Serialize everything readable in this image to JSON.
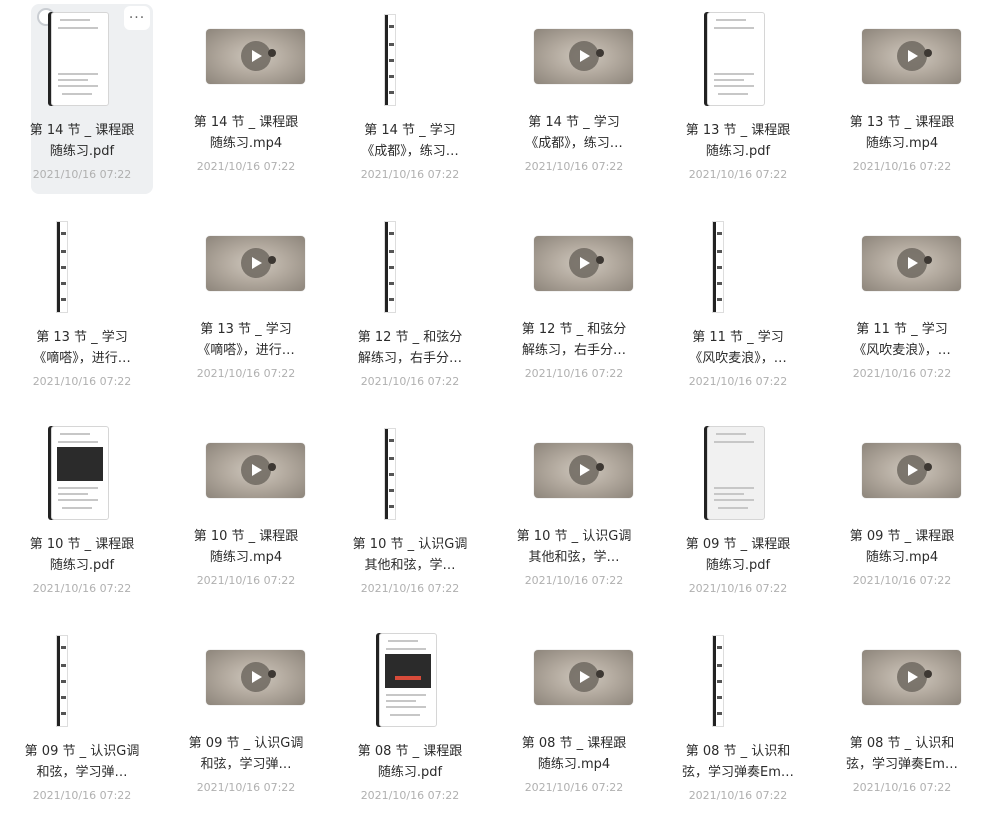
{
  "files": [
    {
      "kind": "pdf",
      "thumb": "doc-page",
      "name": "第 14 节 _ 课程跟随练习.pdf",
      "date": "2021/10/16 07:22",
      "selected": true
    },
    {
      "kind": "mp4",
      "thumb": "video",
      "name": "第 14 节 _ 课程跟随练习.mp4",
      "date": "2021/10/16 07:22"
    },
    {
      "kind": "pdf",
      "thumb": "doc-narrow",
      "name": "第 14 节 _ 学习《成都》，练习…",
      "date": "2021/10/16 07:22"
    },
    {
      "kind": "mp4",
      "thumb": "video",
      "name": "第 14 节 _ 学习《成都》，练习…",
      "date": "2021/10/16 07:22"
    },
    {
      "kind": "pdf",
      "thumb": "doc-page",
      "name": "第 13 节 _ 课程跟随练习.pdf",
      "date": "2021/10/16 07:22"
    },
    {
      "kind": "mp4",
      "thumb": "video",
      "name": "第 13 节 _ 课程跟随练习.mp4",
      "date": "2021/10/16 07:22"
    },
    {
      "kind": "pdf",
      "thumb": "doc-narrow",
      "name": "第 13 节 _ 学习《嘀嗒》，进行…",
      "date": "2021/10/16 07:22"
    },
    {
      "kind": "mp4",
      "thumb": "video",
      "name": "第 13 节 _ 学习《嘀嗒》，进行…",
      "date": "2021/10/16 07:22"
    },
    {
      "kind": "pdf",
      "thumb": "doc-narrow",
      "name": "第 12 节 _ 和弦分解练习，右手分…",
      "date": "2021/10/16 07:22"
    },
    {
      "kind": "mp4",
      "thumb": "video",
      "name": "第 12 节 _ 和弦分解练习，右手分…",
      "date": "2021/10/16 07:22"
    },
    {
      "kind": "pdf",
      "thumb": "doc-narrow",
      "name": "第 11 节 _ 学习《风吹麦浪》，…",
      "date": "2021/10/16 07:22"
    },
    {
      "kind": "mp4",
      "thumb": "video",
      "name": "第 11 节 _ 学习《风吹麦浪》，…",
      "date": "2021/10/16 07:22"
    },
    {
      "kind": "pdf",
      "thumb": "doc-page-dark",
      "name": "第 10 节 _ 课程跟随练习.pdf",
      "date": "2021/10/16 07:22"
    },
    {
      "kind": "mp4",
      "thumb": "video",
      "name": "第 10 节 _ 课程跟随练习.mp4",
      "date": "2021/10/16 07:22"
    },
    {
      "kind": "pdf",
      "thumb": "doc-narrow",
      "name": "第 10 节 _ 认识G调其他和弦，学…",
      "date": "2021/10/16 07:22"
    },
    {
      "kind": "mp4",
      "thumb": "video",
      "name": "第 10 节 _ 认识G调其他和弦，学…",
      "date": "2021/10/16 07:22"
    },
    {
      "kind": "pdf",
      "thumb": "doc-page-gray",
      "name": "第 09 节 _ 课程跟随练习.pdf",
      "date": "2021/10/16 07:22"
    },
    {
      "kind": "mp4",
      "thumb": "video",
      "name": "第 09 节 _ 课程跟随练习.mp4",
      "date": "2021/10/16 07:22"
    },
    {
      "kind": "pdf",
      "thumb": "doc-narrow",
      "name": "第 09 节 _ 认识G调和弦，学习弹…",
      "date": "2021/10/16 07:22"
    },
    {
      "kind": "mp4",
      "thumb": "video",
      "name": "第 09 节 _ 认识G调和弦，学习弹…",
      "date": "2021/10/16 07:22"
    },
    {
      "kind": "pdf",
      "thumb": "doc-page-banner",
      "name": "第 08 节 _ 课程跟随练习.pdf",
      "date": "2021/10/16 07:22"
    },
    {
      "kind": "mp4",
      "thumb": "video",
      "name": "第 08 节 _ 课程跟随练习.mp4",
      "date": "2021/10/16 07:22"
    },
    {
      "kind": "pdf",
      "thumb": "doc-narrow",
      "name": "第 08 节 _ 认识和弦，学习弹奏Em…",
      "date": "2021/10/16 07:22"
    },
    {
      "kind": "mp4",
      "thumb": "video",
      "name": "第 08 节 _ 认识和弦，学习弹奏Em…",
      "date": "2021/10/16 07:22"
    }
  ],
  "more_button": "···"
}
